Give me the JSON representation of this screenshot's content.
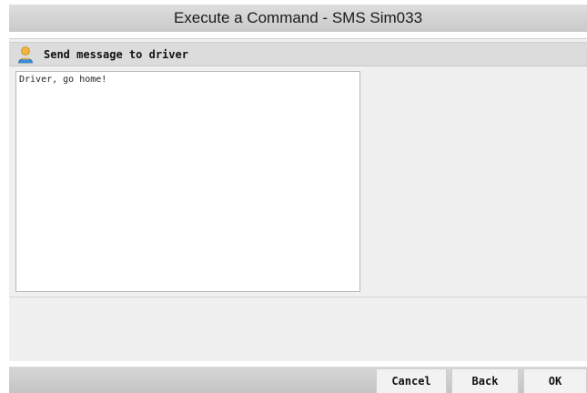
{
  "window": {
    "title": "Execute a Command - SMS Sim033"
  },
  "section": {
    "label": "Send message to driver",
    "icon": "user-icon"
  },
  "message": {
    "value": "Driver, go home!"
  },
  "buttons": {
    "cancel": "Cancel",
    "back": "Back",
    "ok": "OK"
  },
  "colors": {
    "title_bar": "#d2d2d2",
    "panel": "#f0f0f0",
    "header": "#dcdcdc",
    "icon_head": "#f2b33d",
    "icon_body": "#3f8fd8"
  }
}
